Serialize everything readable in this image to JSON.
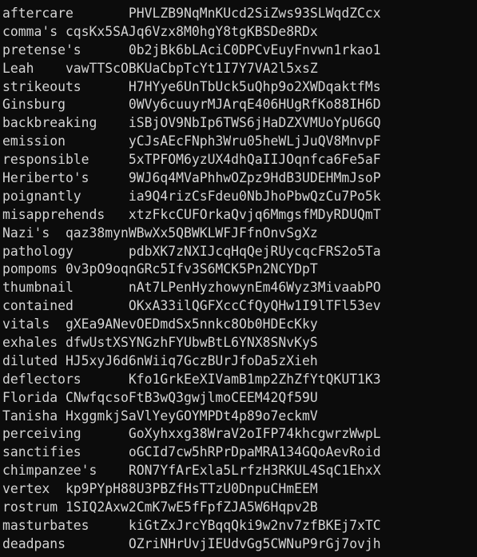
{
  "terminal": {
    "lines": [
      "aftercare       PHVLZB9NqMnKUcd2SiZws93SLWqdZCcx",
      "comma's cqsKx5SAJq6Vzx8M0hgY8tgKBSDe8RDx",
      "pretense's      0b2jBk6bLAciC0DPCvEuyFnvwn1rkao1",
      "Leah    vawTTScOBKUaCbpTcYt1I7Y7VA2l5xsZ",
      "strikeouts      H7HYye6UnTbUck5uQhp9o2XWDqaktfMs",
      "Ginsburg        0WVy6cuuyrMJArqE406HUgRfKo88IH6D",
      "backbreaking    iSBjOV9NbIp6TWS6jHaDZXVMUoYpU6GQ",
      "emission        yCJsAEcFNph3Wru05heWLjJuQV8MnvpF",
      "responsible     5xTPFOM6yzUX4dhQaIIJOqnfca6Fe5aF",
      "Heriberto's     9WJ6q4MVaPhhwOZpz9HdB3UDEHMmJsoP",
      "poignantly      ia9Q4rizCsFdeu0NbJhoPbwQzCu7Po5k",
      "misapprehends   xtzFkcCUFOrkaQvjq6MmgsfMDyRDUQmT",
      "Nazi's  qaz38mynWBwXx5QBWKLWFJFfnOnvSgXz",
      "pathology       pdbXK7zNXIJcqHqQejRUycqcFRS2o5Ta",
      "pompoms 0v3pO9oqnGRc5Ifv3S6MCK5Pn2NCYDpT",
      "thumbnail       nAt7LPenHyzhowynEm46Wyz3MivaabPO",
      "contained       OKxA33ilQGFXccCfQyQHw1I9lTFl53ev",
      "vitals  gXEa9ANevOEDmdSx5nnkc8Ob0HDEcKky",
      "exhales dfwUstXSYNGzhFYUbwBtL6YNX8SNvKyS",
      "diluted HJ5xyJ6d6nWiiq7GczBUrJfoDa5zXieh",
      "deflectors      Kfo1GrkEeXIVamB1mp2ZhZfYtQKUT1K3",
      "Florida CNwfqcsoFtB3wQ3gwjlmoCEEM42Qf59U",
      "Tanisha HxggmkjSaVlYeyGOYMPDt4p89o7eckmV",
      "perceiving      GoXyhxxg38WraV2oIFP74khcgwrzWwpL",
      "sanctifies      oGCId7cw5hRPrDpaMRA134GQoAevRoid",
      "chimpanzee's    RON7YfArExla5LrfzH3RKUL4SqC1EhxX",
      "vertex  kp9PYpH88U3PBZfHsTTzU0DnpuCHmEEM",
      "rostrum 1SIQ2Axw2CmK7wE5fFpfZJA5W6Hqpv2B",
      "masturbates     kiGtZxJrcYBqqQki9w2nv7zfBKEj7xTC",
      "deadpans        OZriNHrUvjIEUdvGg5CWNuP9rGj7ovjh"
    ]
  }
}
